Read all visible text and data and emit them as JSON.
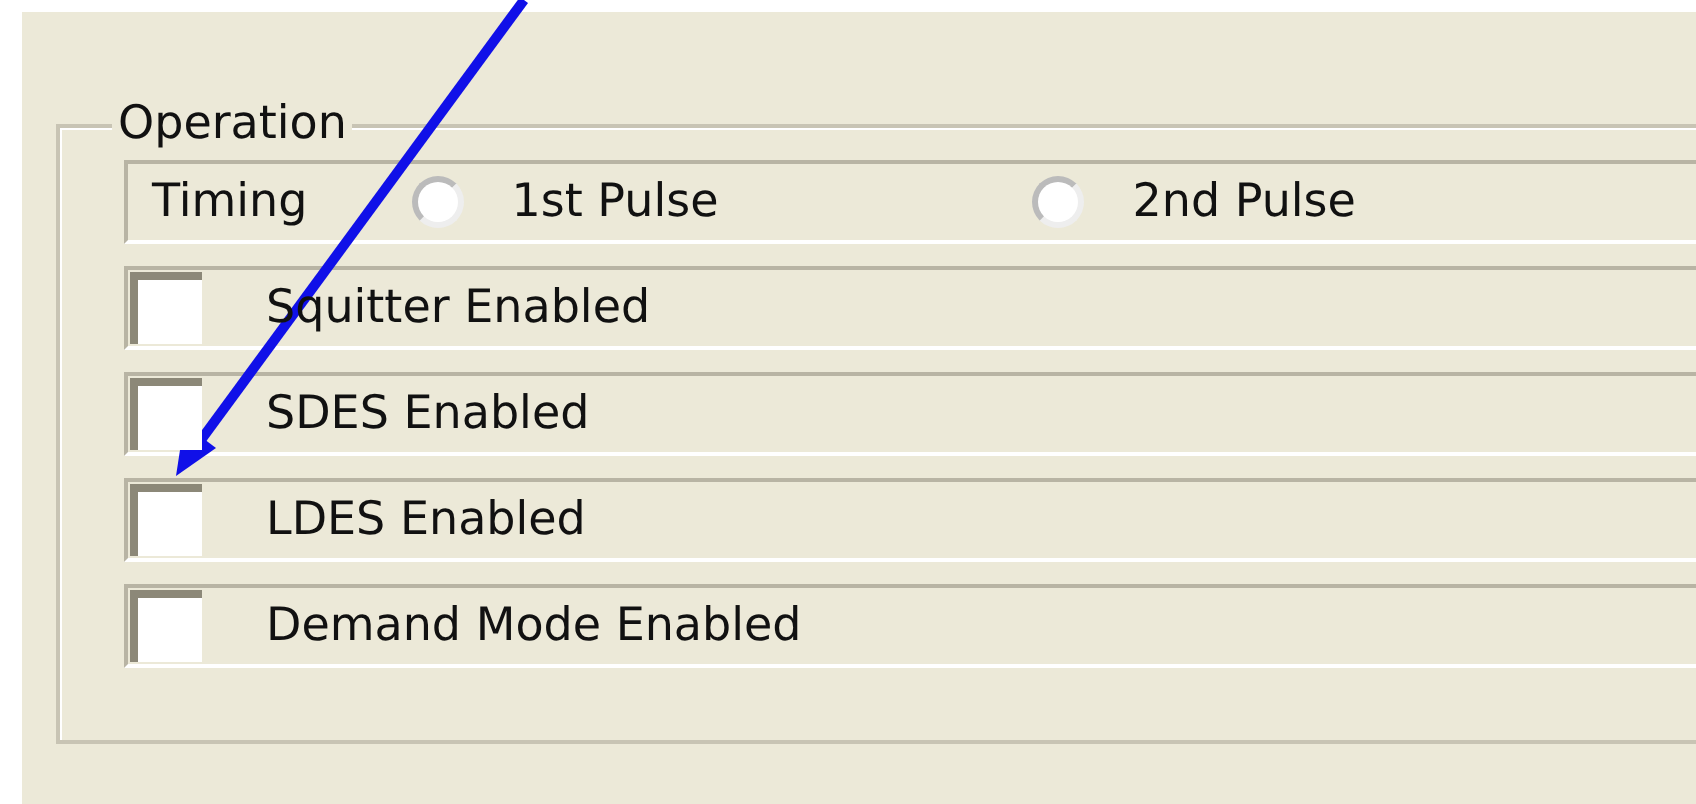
{
  "group": {
    "title": "Operation",
    "timing": {
      "label": "Timing",
      "options": [
        {
          "label": "1st Pulse",
          "selected": false
        },
        {
          "label": "2nd Pulse",
          "selected": false
        }
      ]
    },
    "checkboxes": [
      {
        "label": "Squitter Enabled",
        "checked": false
      },
      {
        "label": "SDES Enabled",
        "checked": false
      },
      {
        "label": "LDES Enabled",
        "checked": false
      },
      {
        "label": "Demand Mode Enabled",
        "checked": false
      }
    ]
  }
}
